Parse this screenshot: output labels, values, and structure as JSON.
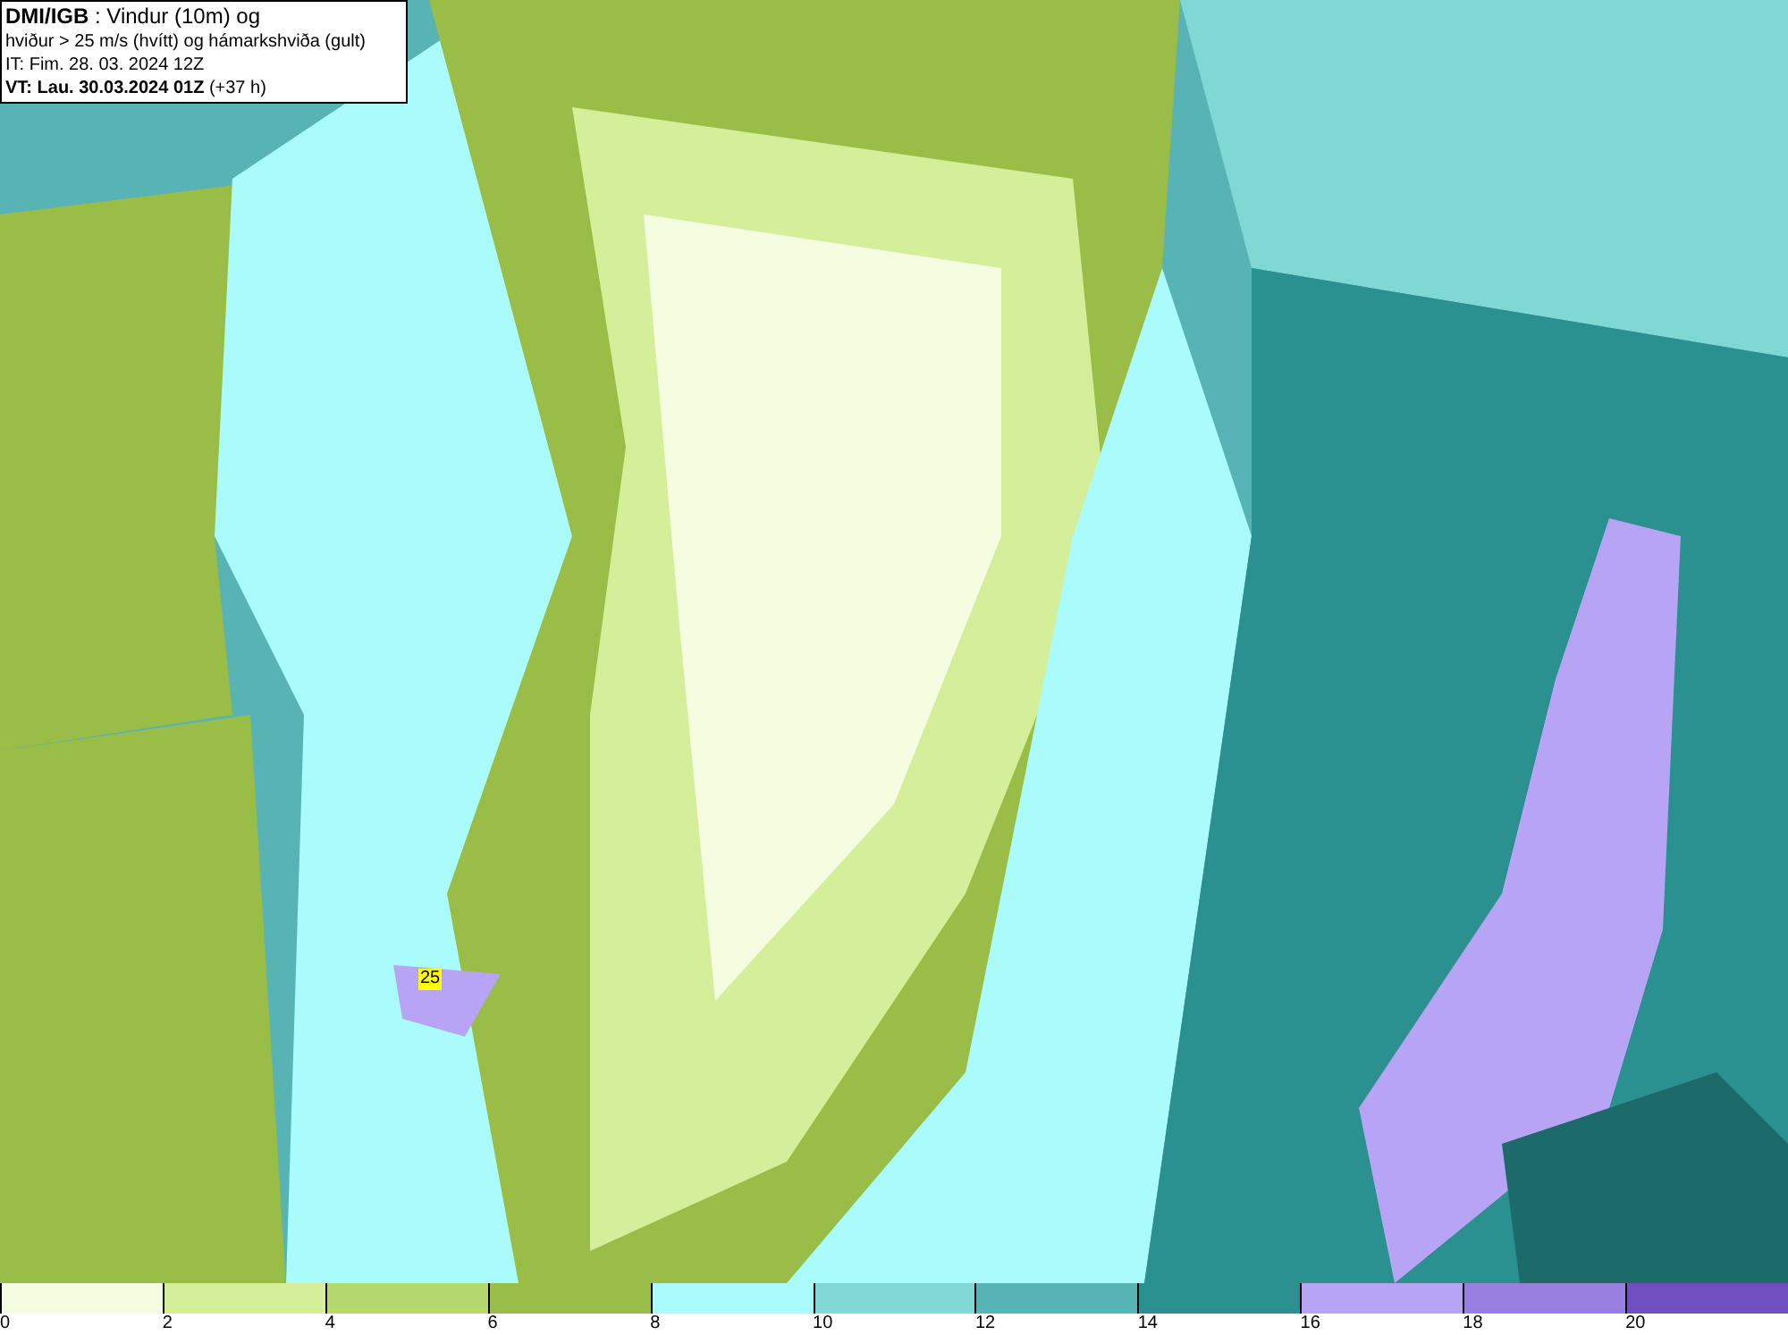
{
  "title_box": {
    "lines": [
      "**DMI/IGB** : Vindur (10m) og",
      "hviður > 25 m/s (hvítt) og hámarkshviða (gult)",
      "IT: Fim. 28. 03. 2024 12Z",
      "**VT: Lau. 30.03.2024 01Z** (+37 h)"
    ]
  },
  "map": {
    "gust_label": "25"
  },
  "legend": [
    {
      "label": "0",
      "color": "#f5fde0"
    },
    {
      "label": "2",
      "color": "#d4ee9a"
    },
    {
      "label": "4",
      "color": "#b5d86e"
    },
    {
      "label": "6",
      "color": "#9abd48"
    },
    {
      "label": "8",
      "color": "#aafcfc"
    },
    {
      "label": "10",
      "color": "#80d8d5"
    },
    {
      "label": "12",
      "color": "#58b4b4"
    },
    {
      "label": "14",
      "color": "#2a9090"
    },
    {
      "label": "16",
      "color": "#b8a4f4"
    },
    {
      "label": "18",
      "color": "#9880e0"
    },
    {
      "label": "20",
      "color": "#7050c0"
    }
  ]
}
